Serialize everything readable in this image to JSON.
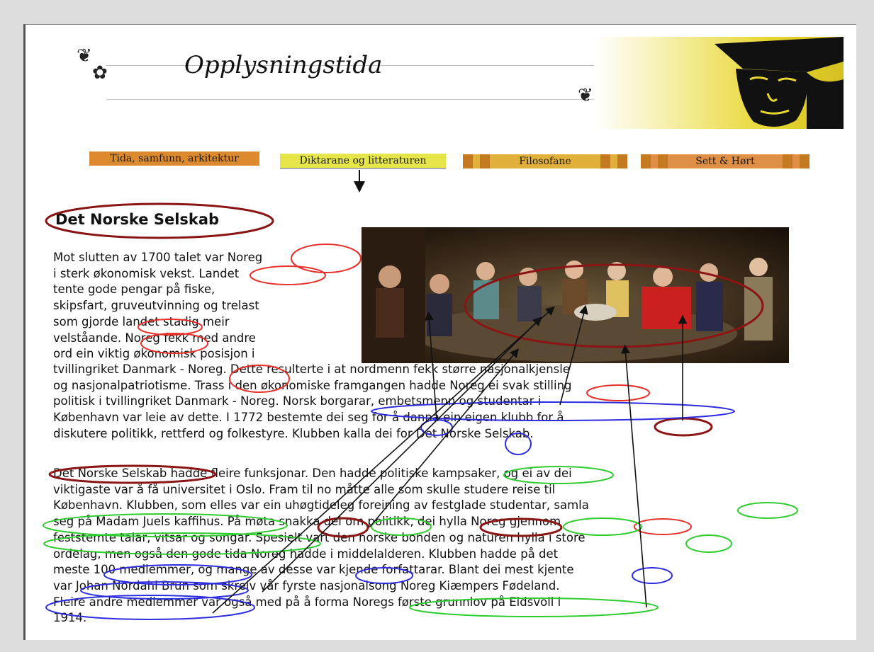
{
  "header": {
    "title": "Opplysningstida"
  },
  "nav": {
    "items": [
      "Tida, samfunn, arkitektur",
      "Diktarane og litteraturen",
      "Filosofane",
      "Sett & Hørt"
    ]
  },
  "article": {
    "heading": "Det Norske Selskab",
    "para1_intro": [
      "Mot slutten av 1700 talet var Noreg",
      "i sterk økonomisk vekst. Landet",
      "tente gode pengar på fiske,",
      "skipsfart, gruveutvinning og trelast",
      "som gjorde landet stadig meir",
      "velståande. Noreg fekk med andre",
      "ord ein viktig økonomisk posisjon i"
    ],
    "para1_rest": [
      "tvillingriket Danmark - Noreg. Dette resulterte i at nordmenn fekk større nasjonalkjensle",
      "og nasjonalpatriotisme. Trass i den økonomiske framgangen hadde Noreg ei svak stilling",
      "politisk i tvillingriket Danmark - Noreg. Norsk borgarar, embetsmenn og studentar i",
      "København var leie av dette. I 1772 bestemte dei seg for å danna ein eigen klubb for å",
      "diskutere politikk, rettferd og folkestyre. Klubben kalla dei for Det Norske Selskab."
    ],
    "para2": [
      "Det Norske Selskab hadde fleire funksjonar. Den hadde politiske kampsaker, og ei av dei",
      "viktigaste var å få universitet i Oslo. Fram til no måtte alle som skulle studere reise til",
      "København. Klubben, som elles var ein uhøgtideleg foreining av festglade studentar, samla",
      "seg på Madam Juels kaffihus. På møta snakka dei om politikk, dei hylla Noreg gjennom",
      "feststemte talar, vitsar og songar. Spesielt vart den norske bonden og naturen hylla i store",
      "ordelag, men også den gode tida Noreg hadde i middelalderen. Klubben hadde på det",
      "meste 100 medlemmer, og mange av desse var kjende forfattarar. Blant dei mest kjente",
      "var Johan Nordahl Brun som skreiv vår fyrste nasjonalsong Noreg Kiæmpers Fødeland.",
      "Fleire andre medlemmer var også med på å forma Noregs første grunnlov på Eidsvoll i",
      "1914."
    ]
  },
  "colors": {
    "annot_red": "#e8302a",
    "annot_darkred": "#8b1414",
    "annot_blue": "#2d2de0",
    "annot_green": "#2ecc2e",
    "nav_orange": "#dd8a2e",
    "nav_yellow": "#e6e64a"
  },
  "icons": {
    "arrow": "down-arrow-icon",
    "ornament": "floral-ornament-icon"
  }
}
